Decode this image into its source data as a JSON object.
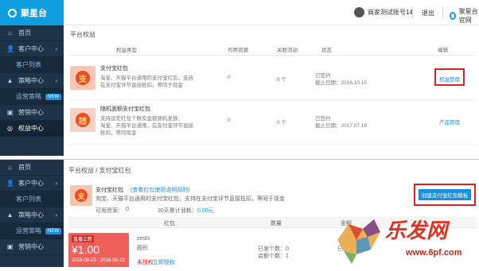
{
  "brand": {
    "name": "聚星台",
    "office": "聚星台官网"
  },
  "user": {
    "name": "商家测试账号14",
    "logout": "退出"
  },
  "sidebar1": [
    {
      "label": "首页",
      "icon": "home-icon",
      "glyph": "⌂"
    },
    {
      "label": "客户中心",
      "icon": "users-icon",
      "glyph": "👤",
      "chev": "›"
    },
    {
      "label": "客户列表",
      "sub": true
    },
    {
      "label": "策略中心",
      "icon": "strategy-icon",
      "glyph": "▲",
      "chev": "›"
    },
    {
      "label": "运营策略",
      "sub": true,
      "badge": "NEW"
    },
    {
      "label": "营销中心",
      "icon": "marketing-icon",
      "glyph": "▣"
    },
    {
      "label": "权益中心",
      "icon": "rights-icon",
      "glyph": "◎",
      "active": true
    }
  ],
  "sidebar2": [
    {
      "label": "首页",
      "icon": "home-icon",
      "glyph": "⌂"
    },
    {
      "label": "客户中心",
      "icon": "users-icon",
      "glyph": "👤",
      "chev": "›"
    },
    {
      "label": "客户列表",
      "sub": true
    },
    {
      "label": "策略中心",
      "icon": "strategy-icon",
      "glyph": "▲",
      "chev": "›"
    },
    {
      "label": "运营策略",
      "sub": true,
      "badge": "NEW"
    },
    {
      "label": "营销中心",
      "icon": "marketing-icon",
      "glyph": "▣"
    }
  ],
  "p1": {
    "crumb": "平台权益",
    "headers": {
      "type": "权益类型",
      "available": "可用资源",
      "activity": "关联活动",
      "status": "状态",
      "edit": "编辑"
    },
    "rows": [
      {
        "glyph": "支",
        "title": "支付宝红包",
        "desc1": "淘宝、天猫平台通用的支付宝红包，支持",
        "desc2": "在支付宝评节直接抵扣，等同于现金",
        "available": "0",
        "activity": "0 个",
        "status": "已签约",
        "deadline": "截止日期：2016.10.15",
        "action": "权益管理"
      },
      {
        "glyph": "随",
        "title": "随机面额支付宝红包",
        "desc1": "支持设定红包个数及金额随机发放、",
        "desc2": "淘宝、天猫平台通用，在支付宝评节直接",
        "desc3": "抵扣，等同现金",
        "available": "0",
        "activity": "0 个",
        "status": "已签约",
        "deadline": "截止日期：2017.07.19",
        "action": "产品管理"
      }
    ]
  },
  "p2": {
    "crumb": "平台权益 / 支付宝红包",
    "title": "支付宝红包",
    "link": "(查看红包使用说明规则)",
    "desc": "淘宝、天猫平台通用的支付宝红包，支持在支付宝评节直接抵扣，等同于现金",
    "glyph": "支",
    "create": "创建支付宝红包模板",
    "available_label": "可用资源：",
    "available": "0",
    "spent_label": "30天累计消耗：",
    "spent": "0.00元",
    "headers": {
      "packet": "红包",
      "qty": "数量",
      "amount": "金额"
    },
    "card": {
      "tag": "直播上新",
      "amount": "¥1.00",
      "dates": "2016-08-23 - 2016-09-22"
    },
    "name": "zeshi",
    "sub": "圆形",
    "unauth": "未授权",
    "auth": "立即授权",
    "sent": "已发个数：0",
    "total": "会额个数：1",
    "edge": "已"
  },
  "watermark": {
    "text": "乐发网",
    "url": "www.6pf.com"
  }
}
